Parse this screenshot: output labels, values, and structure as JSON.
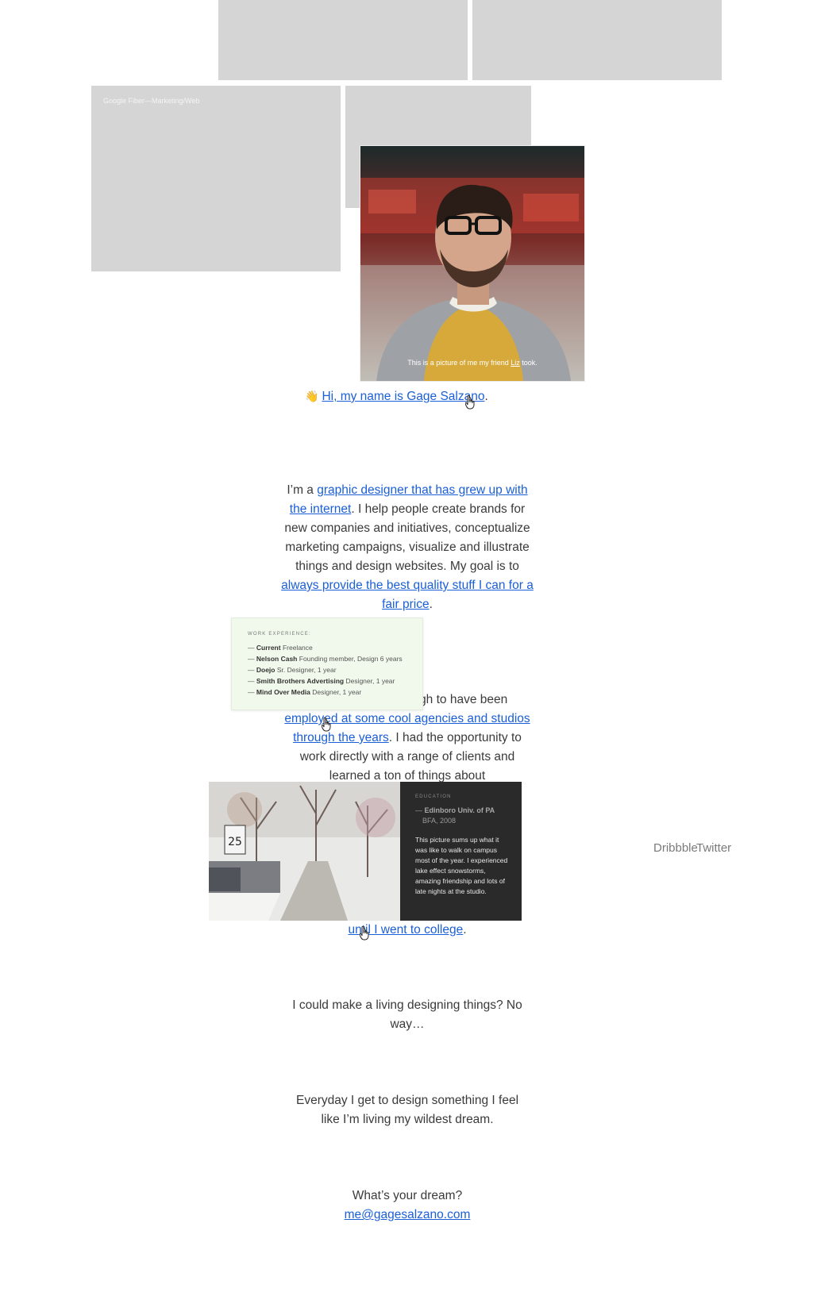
{
  "tiles": {
    "fiber_caption": "Google Fiber—Marketing/Web"
  },
  "portrait": {
    "caption_prefix": "This is a picture of me my friend ",
    "caption_link": "Liz",
    "caption_suffix": " took."
  },
  "intro": {
    "wave": "👋",
    "greeting_link": "Hi, my name is Gage Salzano",
    "greeting_end": "."
  },
  "about": {
    "p1_a": "I’m a ",
    "p1_link1": "graphic designer that has grew up with the internet",
    "p1_b": ". I help people create brands for new companies and initiatives, conceptualize marketing campaigns, visualize and illustrate things and design websites. My goal is to ",
    "p1_link2": "always provide the best quality stuff I can for a fair price",
    "p1_c": ".",
    "p2_a": "I’ve been lucky enough to have been ",
    "p2_link": "employed at some cool agencies and studios through the years",
    "p2_b": ". I had the opportunity to work directly with a range of clients and learned a ton of things about",
    "p3_link": "until I went to college",
    "p3_end": ".",
    "p4": "I could make a living designing things? No way…",
    "p5": "Everyday I get to design something I feel like I’m living my wildest dream.",
    "p6": "What’s your dream?",
    "email": "me@gagesalzano.com"
  },
  "work": {
    "title": "WORK EXPERIENCE:",
    "items": [
      {
        "company": "Current",
        "role": "Freelance"
      },
      {
        "company": "Nelson Cash",
        "role": "Founding member, Design 6 years"
      },
      {
        "company": "Doejo",
        "role": "Sr. Designer, 1 year"
      },
      {
        "company": "Smith Brothers Advertising",
        "role": "Designer, 1 year"
      },
      {
        "company": "Mind Over Media",
        "role": "Designer, 1 year"
      }
    ]
  },
  "education": {
    "title": "EDUCATION",
    "school": "Edinboro Univ. of PA",
    "degree": "BFA, 2008",
    "description": "This picture sums up what it was like to walk on campus most of the year. I experienced lake effect snowstorms, amazing friendship and lots of late nights at the studio.",
    "sign_text": "25"
  },
  "social": {
    "dribbble": "Dribbble",
    "twitter": "Twitter"
  },
  "colors": {
    "link": "#1a5fd6",
    "tile": "#d6d5d6",
    "work_card_bg": "#f1f9ec",
    "edu_card_bg": "#2a2a2a"
  }
}
